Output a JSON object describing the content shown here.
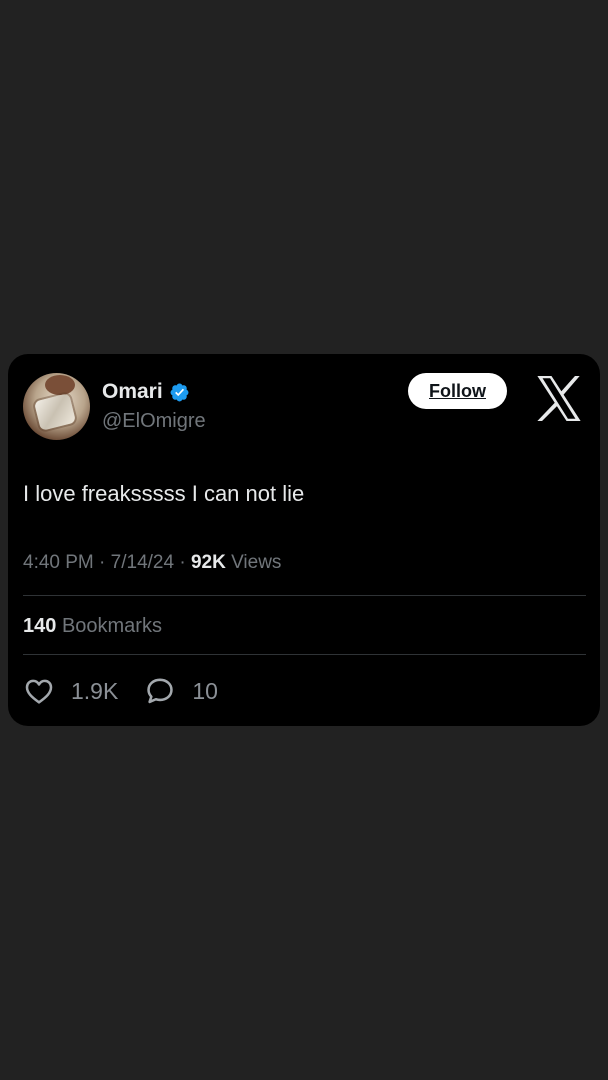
{
  "tweet": {
    "author": {
      "name": "Omari",
      "handle": "@ElOmigre",
      "verified": true
    },
    "follow_label": "Follow",
    "text": "I love freaksssss I can not lie",
    "time": "4:40 PM",
    "date": "7/14/24",
    "views_count": "92K",
    "views_label": "Views",
    "separator": "·",
    "bookmarks_count": "140",
    "bookmarks_label": "Bookmarks",
    "likes_count": "1.9K",
    "replies_count": "10"
  },
  "icons": {
    "verified": "verified-badge-icon",
    "brand": "x-logo-icon",
    "like": "heart-icon",
    "reply": "speech-bubble-icon"
  },
  "colors": {
    "page_background": "#222222",
    "card_background": "#000000",
    "primary_text": "#e7e9ea",
    "secondary_text": "#71767b",
    "verified_blue": "#1d9bf0",
    "divider": "#2f3336"
  }
}
